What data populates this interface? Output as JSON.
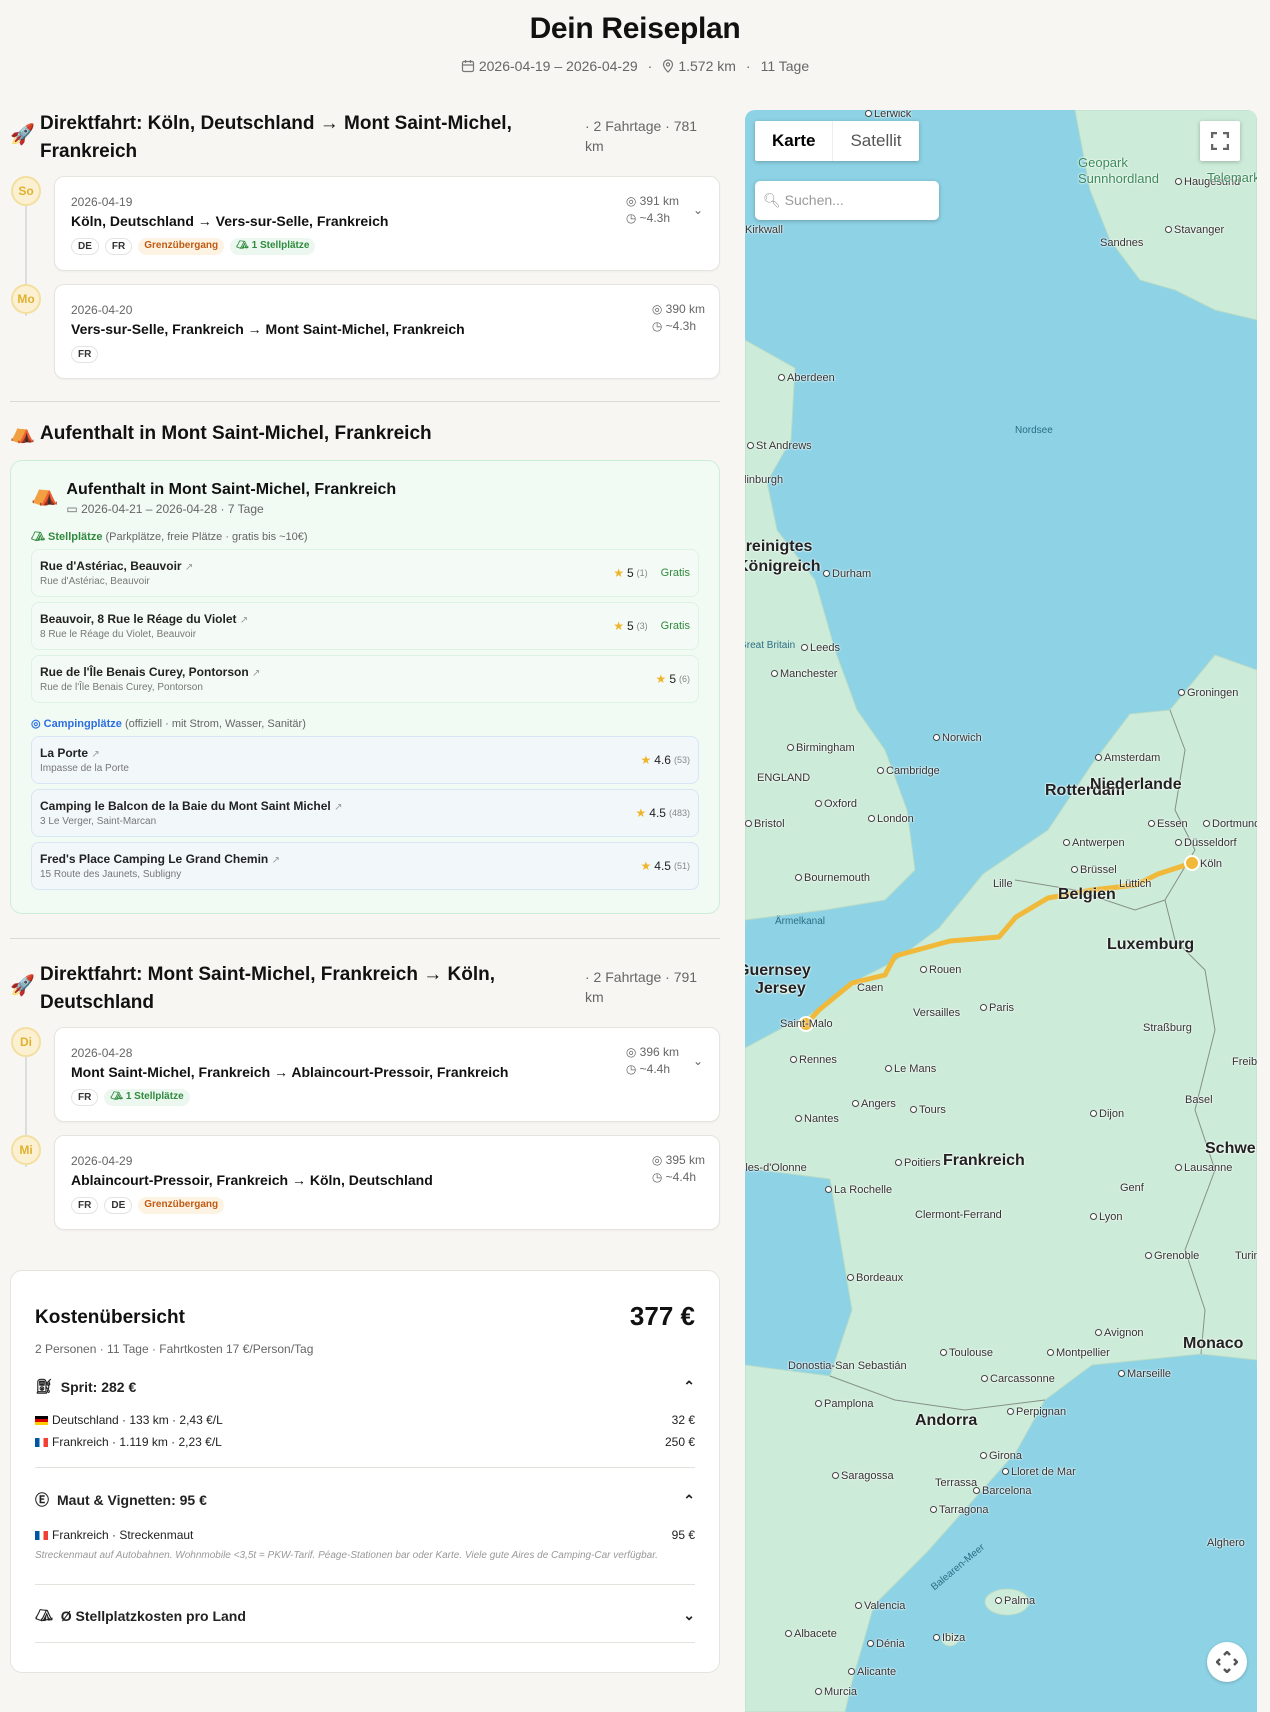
{
  "header": {
    "title": "Dein Reiseplan",
    "dates": "2026-04-19 – 2026-04-29",
    "distance": "1.572 km",
    "days": "11 Tage"
  },
  "sections": [
    {
      "icon": "rocket",
      "title": "Direktfahrt: Köln, Deutschland → Mont Saint-Michel, Frankreich",
      "summary": "· 2 Fahrtage · 781 km",
      "days": [
        {
          "weekday": "So",
          "date": "2026-04-19",
          "route": "Köln, Deutschland → Vers-sur-Selle, Frankreich",
          "km": "391 km",
          "time": "~4.3h",
          "tags": [
            "DE",
            "FR"
          ],
          "border": "Grenzübergang",
          "spots": "1 Stellplätze",
          "expandable": true
        },
        {
          "weekday": "Mo",
          "date": "2026-04-20",
          "route": "Vers-sur-Selle, Frankreich → Mont Saint-Michel, Frankreich",
          "km": "390 km",
          "time": "~4.3h",
          "tags": [
            "FR"
          ]
        }
      ]
    },
    {
      "icon": "tent",
      "title": "Aufenthalt in Mont Saint-Michel, Frankreich"
    },
    {
      "icon": "rocket",
      "title": "Direktfahrt: Mont Saint-Michel, Frankreich → Köln, Deutschland",
      "summary": "· 2 Fahrtage · 791 km",
      "days": [
        {
          "weekday": "Di",
          "date": "2026-04-28",
          "route": "Mont Saint-Michel, Frankreich → Ablaincourt-Pressoir, Frankreich",
          "km": "396 km",
          "time": "~4.4h",
          "tags": [
            "FR"
          ],
          "spots": "1 Stellplätze",
          "expandable": true
        },
        {
          "weekday": "Mi",
          "date": "2026-04-29",
          "route": "Ablaincourt-Pressoir, Frankreich → Köln, Deutschland",
          "km": "395 km",
          "time": "~4.4h",
          "tags": [
            "FR",
            "DE"
          ],
          "border": "Grenzübergang"
        }
      ]
    }
  ],
  "stay": {
    "title": "Aufenthalt in Mont Saint-Michel, Frankreich",
    "dates": "2026-04-21 – 2026-04-28 · 7 Tage",
    "stellplaetze_label": "Stellplätze",
    "stellplaetze_desc": "(Parkplätze, freie Plätze · gratis bis ~10€)",
    "stellplaetze": [
      {
        "name": "Rue d'Astériac, Beauvoir",
        "address": "Rue d'Astériac, Beauvoir",
        "rating": "5",
        "count": "(1)",
        "price": "Gratis"
      },
      {
        "name": "Beauvoir, 8 Rue le Réage du Violet",
        "address": "8 Rue le Réage du Violet, Beauvoir",
        "rating": "5",
        "count": "(3)",
        "price": "Gratis"
      },
      {
        "name": "Rue de l'Île Benais Curey, Pontorson",
        "address": "Rue de l'Île Benais Curey, Pontorson",
        "rating": "5",
        "count": "(6)"
      }
    ],
    "camping_label": "Campingplätze",
    "camping_desc": "(offiziell · mit Strom, Wasser, Sanitär)",
    "camping": [
      {
        "name": "La Porte",
        "address": "Impasse de la Porte",
        "rating": "4.6",
        "count": "(53)"
      },
      {
        "name": "Camping le Balcon de la Baie du Mont Saint Michel",
        "address": "3 Le Verger, Saint-Marcan",
        "rating": "4.5",
        "count": "(483)"
      },
      {
        "name": "Fred's Place Camping Le Grand Chemin",
        "address": "15 Route des Jaunets, Subligny",
        "rating": "4.5",
        "count": "(51)"
      }
    ]
  },
  "costs": {
    "title": "Kostenübersicht",
    "total": "377 €",
    "subtitle": "2 Personen · 11 Tage · Fahrtkosten 17 €/Person/Tag",
    "fuel": {
      "title": "Sprit: 282 €",
      "rows": [
        {
          "label": "Deutschland · 133 km · 2,43 €/L",
          "value": "32 €"
        },
        {
          "label": "Frankreich · 1.119 km · 2,23 €/L",
          "value": "250 €"
        }
      ]
    },
    "toll": {
      "title": "Maut & Vignetten: 95 €",
      "rows": [
        {
          "label": "Frankreich · Streckenmaut",
          "value": "95 €"
        }
      ],
      "note": "Streckenmaut auf Autobahnen. Wohnmobile <3,5t = PKW-Tarif. Péage-Stationen bar oder Karte. Viele gute Aires de Camping-Car verfügbar."
    },
    "pitch": {
      "title": "Ø Stellplatzkosten pro Land"
    }
  },
  "map": {
    "tab_map": "Karte",
    "tab_satellite": "Satellit",
    "active_tab": "Karte",
    "search_placeholder": "Suchen...",
    "route_color": "#f0b93a",
    "labels": {
      "lerwick": "Lerwick",
      "geopark": "Geopark Sunnhordland",
      "haugesund": "Haugesund",
      "stavanger": "Stavanger",
      "sandnes": "Sandnes",
      "kirkwall": "Kirkwall",
      "aberdeen": "Aberdeen",
      "nordsee": "Nordsee",
      "standrews": "St Andrews",
      "edinburgh": "Edinburgh",
      "uk1": "Vereinigtes",
      "uk2": "Königreich",
      "durham": "Durham",
      "greatbritain": "Great Britain",
      "leeds": "Leeds",
      "manchester": "Manchester",
      "birmingham": "Birmingham",
      "england": "ENGLAND",
      "cambridge": "Cambridge",
      "norwich": "Norwich",
      "oxford": "Oxford",
      "london": "London",
      "bristol": "Bristol",
      "bournemouth": "Bournemouth",
      "aermelkanal": "Ärmelkanal",
      "groningen": "Groningen",
      "amsterdam": "Amsterdam",
      "rotterdam": "Rotterdam",
      "niederlande": "Niederlande",
      "essen": "Essen",
      "dortmund": "Dortmund",
      "duesseldorf": "Düsseldorf",
      "koeln": "Köln",
      "antwerpen": "Antwerpen",
      "bruessel": "Brüssel",
      "lille": "Lille",
      "belgien": "Belgien",
      "luettich": "Lüttich",
      "luxemburg": "Luxemburg",
      "rouen": "Rouen",
      "paris": "Paris",
      "caen": "Caen",
      "saintmalo": "Saint-Malo",
      "guernsey": "Guernsey",
      "jersey": "Jersey",
      "versailles": "Versailles",
      "strassburg": "Straßburg",
      "freiburg": "Freiburg",
      "rennes": "Rennes",
      "lemans": "Le Mans",
      "angers": "Angers",
      "tours": "Tours",
      "nantes": "Nantes",
      "dijon": "Dijon",
      "basel": "Basel",
      "frankreich": "Frankreich",
      "poitiers": "Poitiers",
      "sables": "Les Sables-d'Olonne",
      "larochelle": "La Rochelle",
      "schweiz": "Schweiz",
      "lausanne": "Lausanne",
      "genf": "Genf",
      "clermont": "Clermont-Ferrand",
      "lyon": "Lyon",
      "grenoble": "Grenoble",
      "turin": "Turin",
      "bordeaux": "Bordeaux",
      "avignon": "Avignon",
      "toulouse": "Toulouse",
      "montpellier": "Montpellier",
      "marseille": "Marseille",
      "monaco": "Monaco",
      "donostia": "Donostia-San Sebastián",
      "pamplona": "Pamplona",
      "carcassonne": "Carcassonne",
      "andorra": "Andorra",
      "perpignan": "Perpignan",
      "girona": "Girona",
      "lloret": "Lloret de Mar",
      "saragossa": "Saragossa",
      "terrassa": "Terrassa",
      "barcelona": "Barcelona",
      "tarragona": "Tarragona",
      "balearen": "Balearen-Meer",
      "valencia": "Valencia",
      "palma": "Palma",
      "albacete": "Albacete",
      "denia": "Dénia",
      "ibiza": "Ibiza",
      "alicante": "Alicante",
      "murcia": "Murcia",
      "alghero": "Alghero",
      "telemark": "Telemark"
    }
  }
}
